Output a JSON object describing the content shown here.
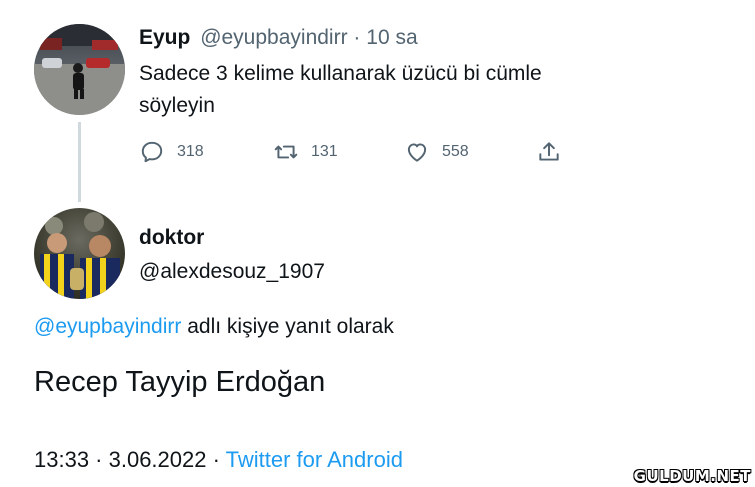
{
  "original_tweet": {
    "display_name": "Eyup",
    "handle": "@eyupbayindirr",
    "separator": "·",
    "time_ago": "10 sa",
    "text_line1": "Sadece 3 kelime kullanarak üzücü bi cümle",
    "text_line2": "söyleyin",
    "actions": {
      "reply_count": "318",
      "retweet_count": "131",
      "like_count": "558"
    }
  },
  "reply_tweet": {
    "display_name": "doktor",
    "handle": "@alexdesouz_1907",
    "reply_to_handle": "@eyupbayindirr",
    "reply_to_suffix": "adlı kişiye yanıt olarak",
    "text": "Recep Tayyip Erdoğan",
    "timestamp": "13:33 · 3.06.2022 ·",
    "source": "Twitter for Android"
  },
  "watermark": "GULDUM.NET",
  "colors": {
    "link": "#1d9bf0",
    "muted": "#536471",
    "text": "#0f1419",
    "thread_line": "#cfd9de"
  }
}
